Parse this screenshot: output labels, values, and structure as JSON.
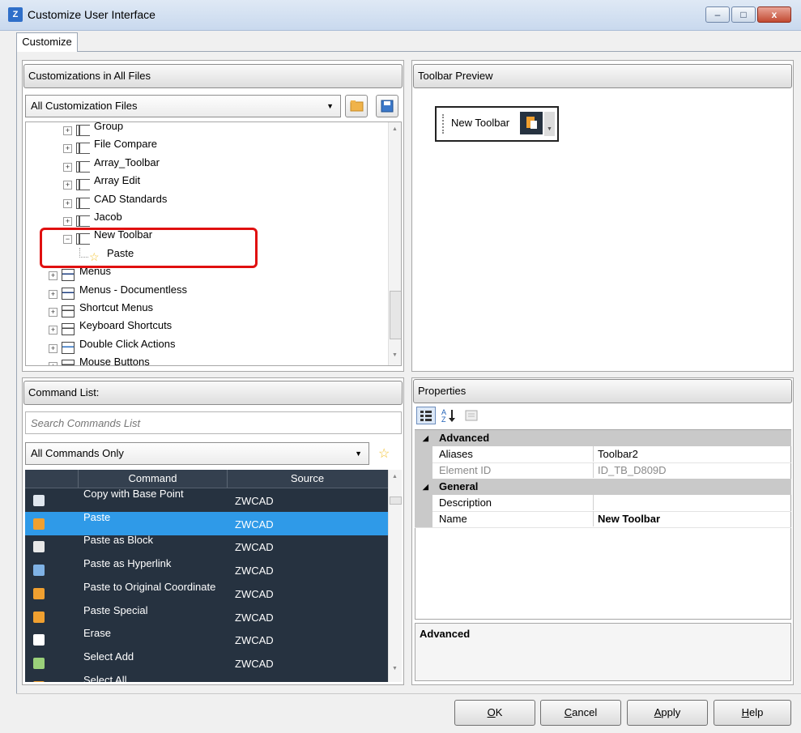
{
  "window": {
    "title": "Customize User Interface",
    "minimize_glyph": "–",
    "maximize_glyph": "□",
    "close_glyph": "x"
  },
  "tabs": {
    "customize": "Customize"
  },
  "customizations_panel": {
    "header": "Customizations in All Files",
    "dropdown_value": "All Customization Files",
    "tree": [
      {
        "label": "Group",
        "icon": "toolbar-icon",
        "expander": "+"
      },
      {
        "label": "File Compare",
        "icon": "toolbar-icon",
        "expander": "+"
      },
      {
        "label": "Array_Toolbar",
        "icon": "toolbar-icon",
        "expander": "+"
      },
      {
        "label": "Array Edit",
        "icon": "toolbar-icon",
        "expander": "+"
      },
      {
        "label": "CAD Standards",
        "icon": "toolbar-icon",
        "expander": "+"
      },
      {
        "label": "Jacob",
        "icon": "toolbar-icon",
        "expander": "+"
      },
      {
        "label": "New Toolbar",
        "icon": "toolbar-icon",
        "expander": "−"
      },
      {
        "label": "Paste",
        "icon": "star-icon"
      },
      {
        "label": "Menus",
        "icon": "menu-icon",
        "expander": "+"
      },
      {
        "label": "Menus - Documentless",
        "icon": "menu-icon",
        "expander": "+"
      },
      {
        "label": "Shortcut Menus",
        "icon": "shortcut-menu-icon",
        "expander": "+"
      },
      {
        "label": "Keyboard Shortcuts",
        "icon": "keyboard-icon",
        "expander": "+"
      },
      {
        "label": "Double Click Actions",
        "icon": "double-click-icon",
        "expander": "+"
      },
      {
        "label": "Mouse Buttons",
        "icon": "mouse-icon",
        "expander": "+"
      }
    ]
  },
  "toolbar_preview": {
    "header": "Toolbar Preview",
    "toolbar_label": "New Toolbar"
  },
  "command_list": {
    "header": "Command List:",
    "search_placeholder": "Search Commands List",
    "filter_value": "All Commands Only",
    "columns": {
      "command": "Command",
      "source": "Source"
    },
    "rows": [
      {
        "name": "Copy with Base Point",
        "source": "ZWCAD",
        "icon_color": "#dfe6ee"
      },
      {
        "name": "Paste",
        "source": "ZWCAD",
        "icon_color": "#f0a030",
        "selected": true
      },
      {
        "name": "Paste as Block",
        "source": "ZWCAD",
        "icon_color": "#e8e8e8"
      },
      {
        "name": "Paste as Hyperlink",
        "source": "ZWCAD",
        "icon_color": "#7fb2e5"
      },
      {
        "name": "Paste to Original Coordinate",
        "source": "ZWCAD",
        "icon_color": "#f0a030"
      },
      {
        "name": "Paste Special",
        "source": "ZWCAD",
        "icon_color": "#f0a030"
      },
      {
        "name": "Erase",
        "source": "ZWCAD",
        "icon_color": "#ffffff"
      },
      {
        "name": "Select Add",
        "source": "ZWCAD",
        "icon_color": "#9ad07a"
      },
      {
        "name": "Select All",
        "source": "",
        "icon_color": "#f0a030"
      }
    ]
  },
  "properties": {
    "header": "Properties",
    "categories": {
      "advanced": "Advanced",
      "general": "General"
    },
    "rows": {
      "aliases": {
        "label": "Aliases",
        "value": "Toolbar2"
      },
      "element_id": {
        "label": "Element ID",
        "value": "ID_TB_D809D"
      },
      "description": {
        "label": "Description",
        "value": ""
      },
      "name": {
        "label": "Name",
        "value": "New Toolbar"
      }
    },
    "help_title": "Advanced"
  },
  "buttons": {
    "ok": {
      "mnemonic": "O",
      "rest": "K"
    },
    "cancel": {
      "mnemonic": "C",
      "rest": "ancel"
    },
    "apply": {
      "mnemonic": "A",
      "rest": "pply"
    },
    "help": {
      "mnemonic": "H",
      "rest": "elp"
    }
  },
  "colors": {
    "highlight_box": "#e01010",
    "selection": "#2f9ae8",
    "command_list_bg": "#263240",
    "property_category": "#c9c9c9"
  }
}
